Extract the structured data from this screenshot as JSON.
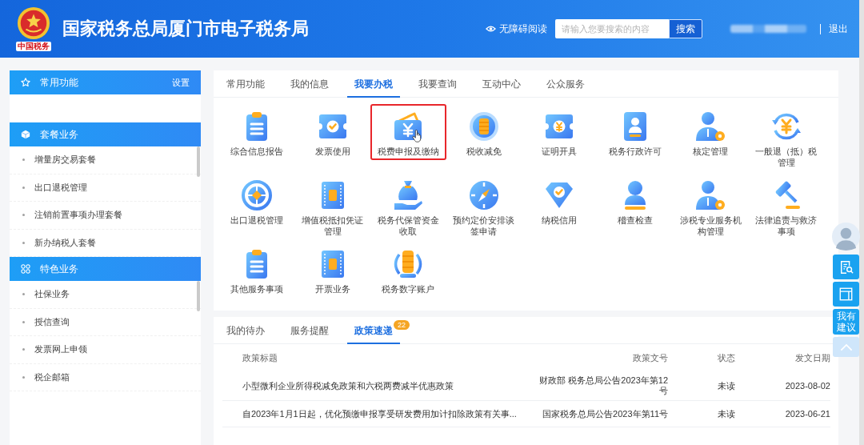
{
  "header": {
    "logo_text": "中国税务",
    "title": "国家税务总局厦门市电子税务局",
    "accessibility_link": "无障碍阅读",
    "search": {
      "placeholder": "请输入您要搜索的内容",
      "button": "搜索"
    },
    "logout": "退出"
  },
  "sidebar": [
    {
      "title": "常用功能",
      "kind": "star",
      "action": "设置"
    },
    {
      "title": "套餐业务",
      "kind": "cube",
      "items": [
        "增量房交易套餐",
        "出口退税管理",
        "注销前置事项办理套餐",
        "新办纳税人套餐"
      ]
    },
    {
      "title": "特色业务",
      "kind": "grid",
      "items": [
        "社保业务",
        "授信查询",
        "发票网上申领",
        "税企邮箱"
      ]
    }
  ],
  "service_tabs": [
    {
      "label": "常用功能",
      "selected": false
    },
    {
      "label": "我的信息",
      "selected": false
    },
    {
      "label": "我要办税",
      "selected": true
    },
    {
      "label": "我要查询",
      "selected": false
    },
    {
      "label": "互动中心",
      "selected": false
    },
    {
      "label": "公众服务",
      "selected": false
    }
  ],
  "services": [
    {
      "label": "综合信息报告",
      "kind": "clipboard",
      "highlighted": false,
      "hovered": false
    },
    {
      "label": "发票使用",
      "kind": "ticket-check",
      "highlighted": false,
      "hovered": false
    },
    {
      "label": "税费申报及缴纳",
      "kind": "wallet-yen",
      "highlighted": true,
      "hovered": true
    },
    {
      "label": "税收减免",
      "kind": "coin",
      "highlighted": false,
      "hovered": false
    },
    {
      "label": "证明开具",
      "kind": "ticket-yen",
      "highlighted": false,
      "hovered": false
    },
    {
      "label": "税务行政许可",
      "kind": "stamp-card",
      "highlighted": false,
      "hovered": false
    },
    {
      "label": "核定管理",
      "kind": "person-gear",
      "highlighted": false,
      "hovered": false
    },
    {
      "label": "一般退（抵）税管理",
      "kind": "yen-cycle",
      "highlighted": false,
      "hovered": false
    },
    {
      "label": "出口退税管理",
      "kind": "globe",
      "highlighted": false,
      "hovered": false
    },
    {
      "label": "增值税抵扣凭证管理",
      "kind": "receipt",
      "highlighted": false,
      "hovered": false
    },
    {
      "label": "税务代保管资金收取",
      "kind": "hand-bag",
      "highlighted": false,
      "hovered": false
    },
    {
      "label": "预约定价安排谈签申请",
      "kind": "compass",
      "highlighted": false,
      "hovered": false
    },
    {
      "label": "纳税信用",
      "kind": "diamond-check",
      "highlighted": false,
      "hovered": false
    },
    {
      "label": "稽查检查",
      "kind": "stamp",
      "highlighted": false,
      "hovered": false
    },
    {
      "label": "涉税专业服务机构管理",
      "kind": "person-gear",
      "highlighted": false,
      "hovered": false
    },
    {
      "label": "法律追责与救济事项",
      "kind": "gavel",
      "highlighted": false,
      "hovered": false
    },
    {
      "label": "其他服务事项",
      "kind": "clipboard",
      "highlighted": false,
      "hovered": false
    },
    {
      "label": "开票业务",
      "kind": "receipt",
      "highlighted": false,
      "hovered": false
    },
    {
      "label": "税务数字账户",
      "kind": "coin-stack",
      "highlighted": false,
      "hovered": false
    }
  ],
  "info_tabs": [
    {
      "label": "我的待办",
      "selected": false
    },
    {
      "label": "服务提醒",
      "selected": false
    },
    {
      "label": "政策速递",
      "selected": true,
      "badge": "22"
    }
  ],
  "policy_table": {
    "columns": [
      "政策标题",
      "政策文号",
      "状态",
      "发文日期"
    ],
    "rows": [
      {
        "title": "小型微利企业所得税减免政策和六税两费减半优惠政策",
        "document_number": "财政部 税务总局公告2023年第12号",
        "status": "未读",
        "date": "2023-08-02"
      },
      {
        "title": "自2023年1月1日起，优化预缴申报享受研发费用加计扣除政策有关事...",
        "document_number": "国家税务总局公告2023年第11号",
        "status": "未读",
        "date": "2023-06-21"
      }
    ]
  },
  "side_tools": [
    {
      "kind": "document-search"
    },
    {
      "kind": "window"
    },
    {
      "kind": "text",
      "label": "我有建议"
    },
    {
      "kind": "back-to-top"
    }
  ]
}
